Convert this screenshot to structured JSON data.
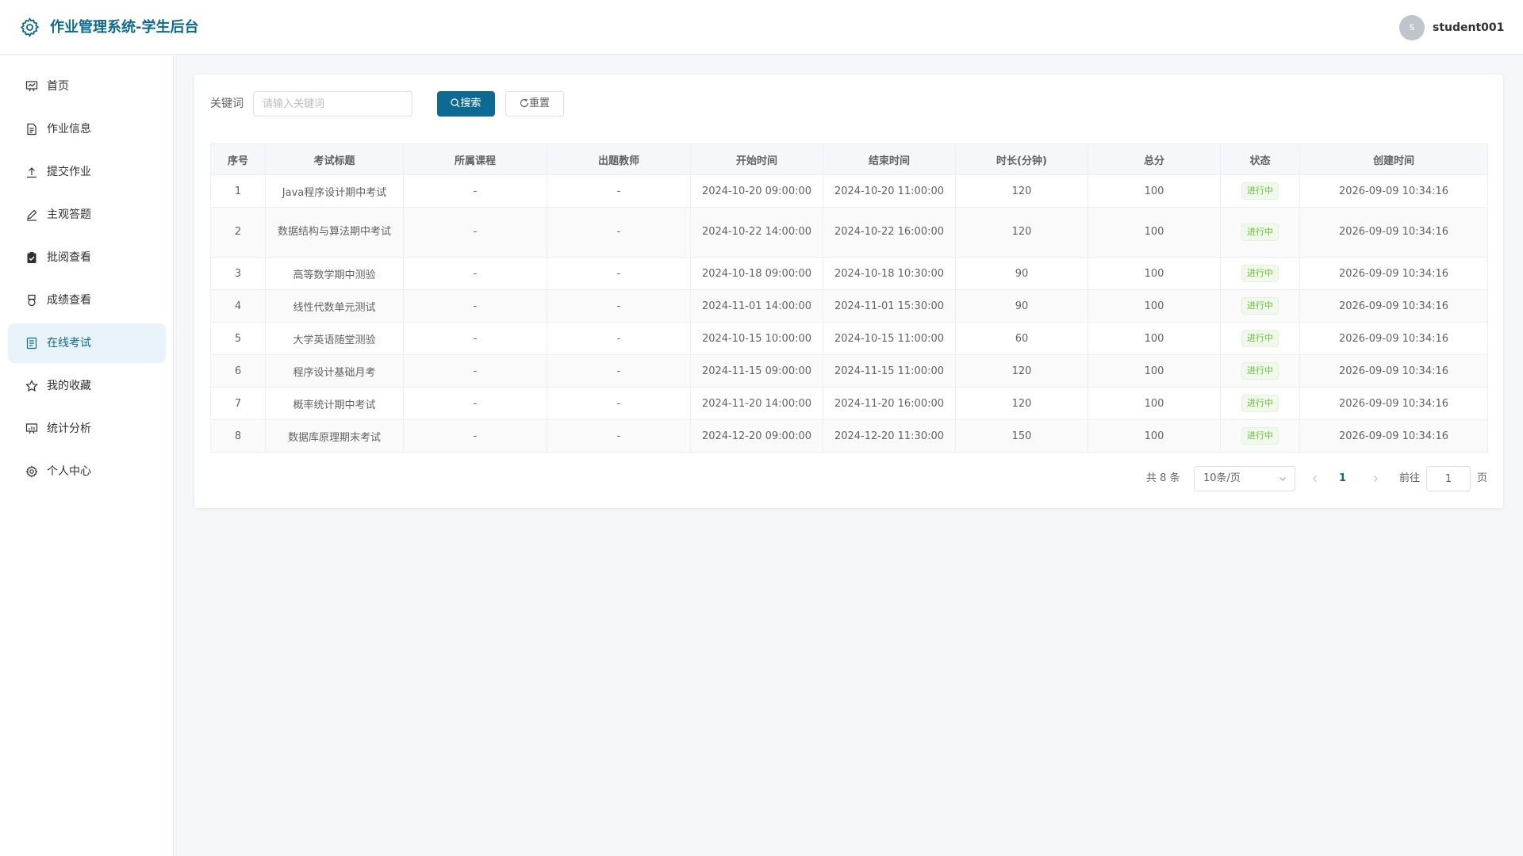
{
  "app": {
    "title": "作业管理系统-学生后台",
    "accent_color": "#0c6a93"
  },
  "user": {
    "avatar_letter": "s",
    "name": "student001"
  },
  "sidebar": {
    "items": [
      {
        "label": "首页",
        "icon": "home-board-icon"
      },
      {
        "label": "作业信息",
        "icon": "document-icon"
      },
      {
        "label": "提交作业",
        "icon": "upload-icon"
      },
      {
        "label": "主观答题",
        "icon": "edit-pen-icon"
      },
      {
        "label": "批阅查看",
        "icon": "clipboard-check-icon"
      },
      {
        "label": "成绩查看",
        "icon": "medal-icon"
      },
      {
        "label": "在线考试",
        "icon": "exam-document-icon",
        "active": true
      },
      {
        "label": "我的收藏",
        "icon": "star-icon"
      },
      {
        "label": "统计分析",
        "icon": "data-board-icon"
      },
      {
        "label": "个人中心",
        "icon": "settings-icon"
      }
    ]
  },
  "search": {
    "label": "关键词",
    "placeholder": "请输入关键词",
    "value": "",
    "search_button": "搜索",
    "reset_button": "重置"
  },
  "table": {
    "columns": [
      "序号",
      "考试标题",
      "所属课程",
      "出题教师",
      "开始时间",
      "结束时间",
      "时长(分钟)",
      "总分",
      "状态",
      "创建时间"
    ],
    "rows": [
      [
        "1",
        "Java程序设计期中考试",
        "-",
        "-",
        "2024-10-20 09:00:00",
        "2024-10-20 11:00:00",
        "120",
        "100",
        "进行中",
        "2026-09-09 10:34:16"
      ],
      [
        "2",
        "数据结构与算法期中考试",
        "-",
        "-",
        "2024-10-22 14:00:00",
        "2024-10-22 16:00:00",
        "120",
        "100",
        "进行中",
        "2026-09-09 10:34:16"
      ],
      [
        "3",
        "高等数学期中测验",
        "-",
        "-",
        "2024-10-18 09:00:00",
        "2024-10-18 10:30:00",
        "90",
        "100",
        "进行中",
        "2026-09-09 10:34:16"
      ],
      [
        "4",
        "线性代数单元测试",
        "-",
        "-",
        "2024-11-01 14:00:00",
        "2024-11-01 15:30:00",
        "90",
        "100",
        "进行中",
        "2026-09-09 10:34:16"
      ],
      [
        "5",
        "大学英语随堂测验",
        "-",
        "-",
        "2024-10-15 10:00:00",
        "2024-10-15 11:00:00",
        "60",
        "100",
        "进行中",
        "2026-09-09 10:34:16"
      ],
      [
        "6",
        "程序设计基础月考",
        "-",
        "-",
        "2024-11-15 09:00:00",
        "2024-11-15 11:00:00",
        "120",
        "100",
        "进行中",
        "2026-09-09 10:34:16"
      ],
      [
        "7",
        "概率统计期中考试",
        "-",
        "-",
        "2024-11-20 14:00:00",
        "2024-11-20 16:00:00",
        "120",
        "100",
        "进行中",
        "2026-09-09 10:34:16"
      ],
      [
        "8",
        "数据库原理期末考试",
        "-",
        "-",
        "2024-12-20 09:00:00",
        "2024-12-20 11:30:00",
        "150",
        "100",
        "进行中",
        "2026-09-09 10:34:16"
      ]
    ]
  },
  "pagination": {
    "total_text": "共 8 条",
    "page_size": "10条/页",
    "current_page": "1",
    "goto_label": "前往",
    "goto_value": "1",
    "goto_unit": "页"
  }
}
